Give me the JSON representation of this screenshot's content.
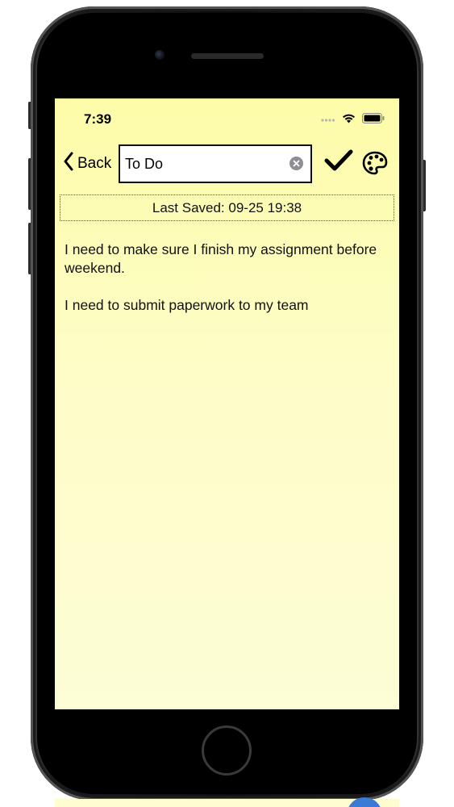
{
  "status_bar": {
    "time": "7:39",
    "icons": [
      "cellular-signal-icon",
      "wifi-icon",
      "battery-icon"
    ]
  },
  "nav": {
    "back_label": "Back",
    "title_value": "To Do",
    "title_placeholder": "",
    "icons": [
      "chevron-left-icon",
      "clear-icon",
      "checkmark-icon",
      "palette-icon"
    ]
  },
  "note": {
    "last_saved": "Last Saved: 09-25 19:38",
    "body": "I need to make sure I finish my assignment before weekend.\n\nI need to submit paperwork to my team"
  },
  "colors": {
    "note_background": "#fdfcb0",
    "text": "#111111",
    "clear_button": "#8e8e93"
  }
}
